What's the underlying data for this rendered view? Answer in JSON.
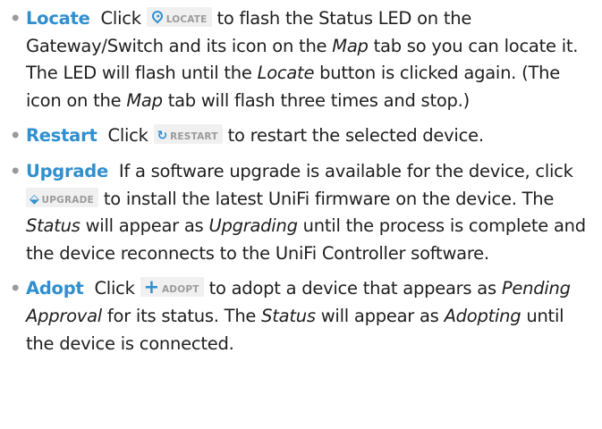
{
  "items": [
    {
      "bullet": "•",
      "term": "Locate",
      "pre": "Click",
      "button": {
        "icon": "map-pin-icon",
        "label": "LOCATE"
      },
      "s1": "to flash the Status LED on the Gateway/Switch and its icon on the",
      "e1": "Map",
      "s2": "tab so you can locate it. The LED will flash until the",
      "e2": "Locate",
      "s3": "button is clicked again. (The icon on the",
      "e3": "Map",
      "s4": "tab will flash three times and stop.)"
    },
    {
      "bullet": "•",
      "term": "Restart",
      "pre": "Click",
      "button": {
        "icon": "restart-icon",
        "glyph": "↻",
        "label": "RESTART"
      },
      "s1": "to restart the selected device."
    },
    {
      "bullet": "•",
      "term": "Upgrade",
      "pre": "If a software upgrade is available for the device, click",
      "button": {
        "icon": "upgrade-icon",
        "glyph": "⬙",
        "label": "UPGRADE"
      },
      "s1": "to install the latest UniFi firmware on the device. The",
      "e1": "Status",
      "s2": "will appear as",
      "e2": "Upgrading",
      "s3": "until the process is complete and the device reconnects to the UniFi Controller software."
    },
    {
      "bullet": "•",
      "term": "Adopt",
      "pre": "Click",
      "button": {
        "icon": "plus-icon",
        "glyph": "+",
        "label": "ADOPT"
      },
      "s1": "to adopt a device that appears as",
      "e1": "Pending Approval",
      "s2": "for its status. The",
      "e2": "Status",
      "s3": "will appear as",
      "e3": "Adopting",
      "s4": "until the device is connected."
    }
  ],
  "colors": {
    "accent": "#2f8fcf",
    "text": "#1e1e1e",
    "bullet": "#9a9a9a",
    "button_bg": "#f0f0f0",
    "button_label": "#9b9b9b"
  }
}
